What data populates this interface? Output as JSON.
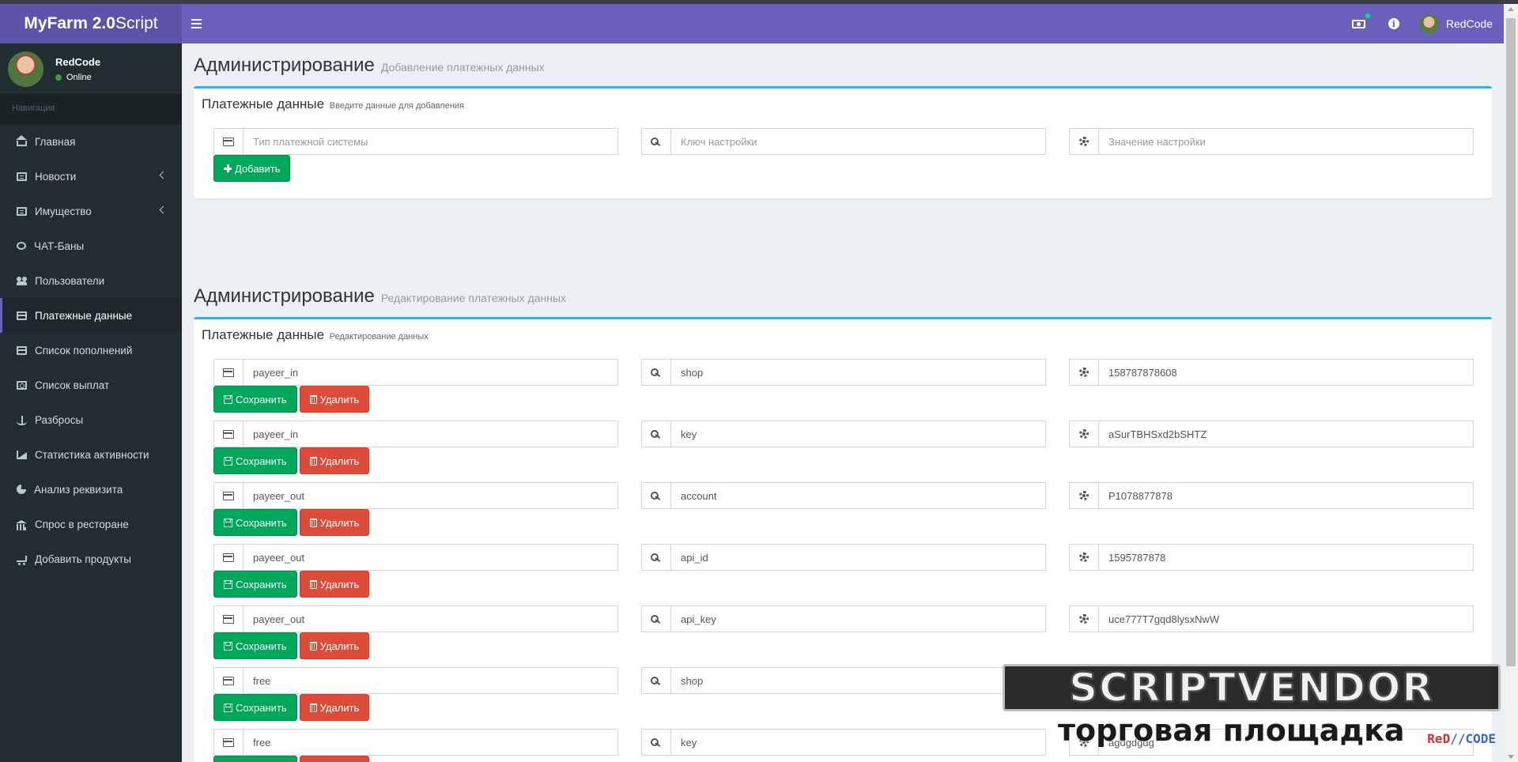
{
  "app": {
    "logo_bold": "MyFarm 2.0",
    "logo_light": "Script"
  },
  "header": {
    "user_name": "RedCode",
    "icons": [
      "bars-icon",
      "money-icon",
      "info-icon"
    ]
  },
  "sidebar": {
    "user_name": "RedCode",
    "status": "Online",
    "nav_header": "Навигация",
    "items": [
      {
        "label": "Главная",
        "icon": "home-icon"
      },
      {
        "label": "Новости",
        "icon": "newspaper-icon",
        "has_submenu": true
      },
      {
        "label": "Имущество",
        "icon": "property-icon",
        "has_submenu": true
      },
      {
        "label": "ЧАТ-Баны",
        "icon": "chat-icon"
      },
      {
        "label": "Пользователи",
        "icon": "users-icon"
      },
      {
        "label": "Платежные данные",
        "icon": "credit-card-icon",
        "active": true
      },
      {
        "label": "Список пополнений",
        "icon": "card-list-icon"
      },
      {
        "label": "Список выплат",
        "icon": "money-icon"
      },
      {
        "label": "Разбросы",
        "icon": "scale-icon"
      },
      {
        "label": "Статистика активности",
        "icon": "area-chart-icon"
      },
      {
        "label": "Анализ реквизита",
        "icon": "pie-chart-icon"
      },
      {
        "label": "Спрос в ресторане",
        "icon": "bank-icon"
      },
      {
        "label": "Добавить продукты",
        "icon": "cart-icon"
      }
    ]
  },
  "add_section": {
    "title": "Администрирование",
    "subtitle": "Добавление платежных данных",
    "box_title": "Платежные данные",
    "box_subtitle": "Введите данные для добавления",
    "placeholders": {
      "type": "Тип платежной системы",
      "key": "Ключ настройки",
      "value": "Значение настройки"
    },
    "add_label": "Добавить"
  },
  "edit_section": {
    "title": "Администрирование",
    "subtitle": "Редактирование платежных данных",
    "box_title": "Платежные данные",
    "box_subtitle": "Редактирование данных",
    "save_label": "Сохранить",
    "delete_label": "Удалить",
    "rows": [
      {
        "type": "payeer_in",
        "key": "shop",
        "value": "158787878608"
      },
      {
        "type": "payeer_in",
        "key": "key",
        "value": "aSurTBHSxd2bSHTZ"
      },
      {
        "type": "payeer_out",
        "key": "account",
        "value": "P1078877878"
      },
      {
        "type": "payeer_out",
        "key": "api_id",
        "value": "1595787878"
      },
      {
        "type": "payeer_out",
        "key": "api_key",
        "value": "uce777T7gqd8lysxNwW"
      },
      {
        "type": "free",
        "key": "shop",
        "value": ""
      },
      {
        "type": "free",
        "key": "key",
        "value": "agdgdgdg"
      }
    ]
  },
  "watermark": {
    "line1": "SCRIPTVENDOR",
    "line2": "торговая площадка",
    "code_red": "ReD",
    "code_rest": "//CODE"
  }
}
